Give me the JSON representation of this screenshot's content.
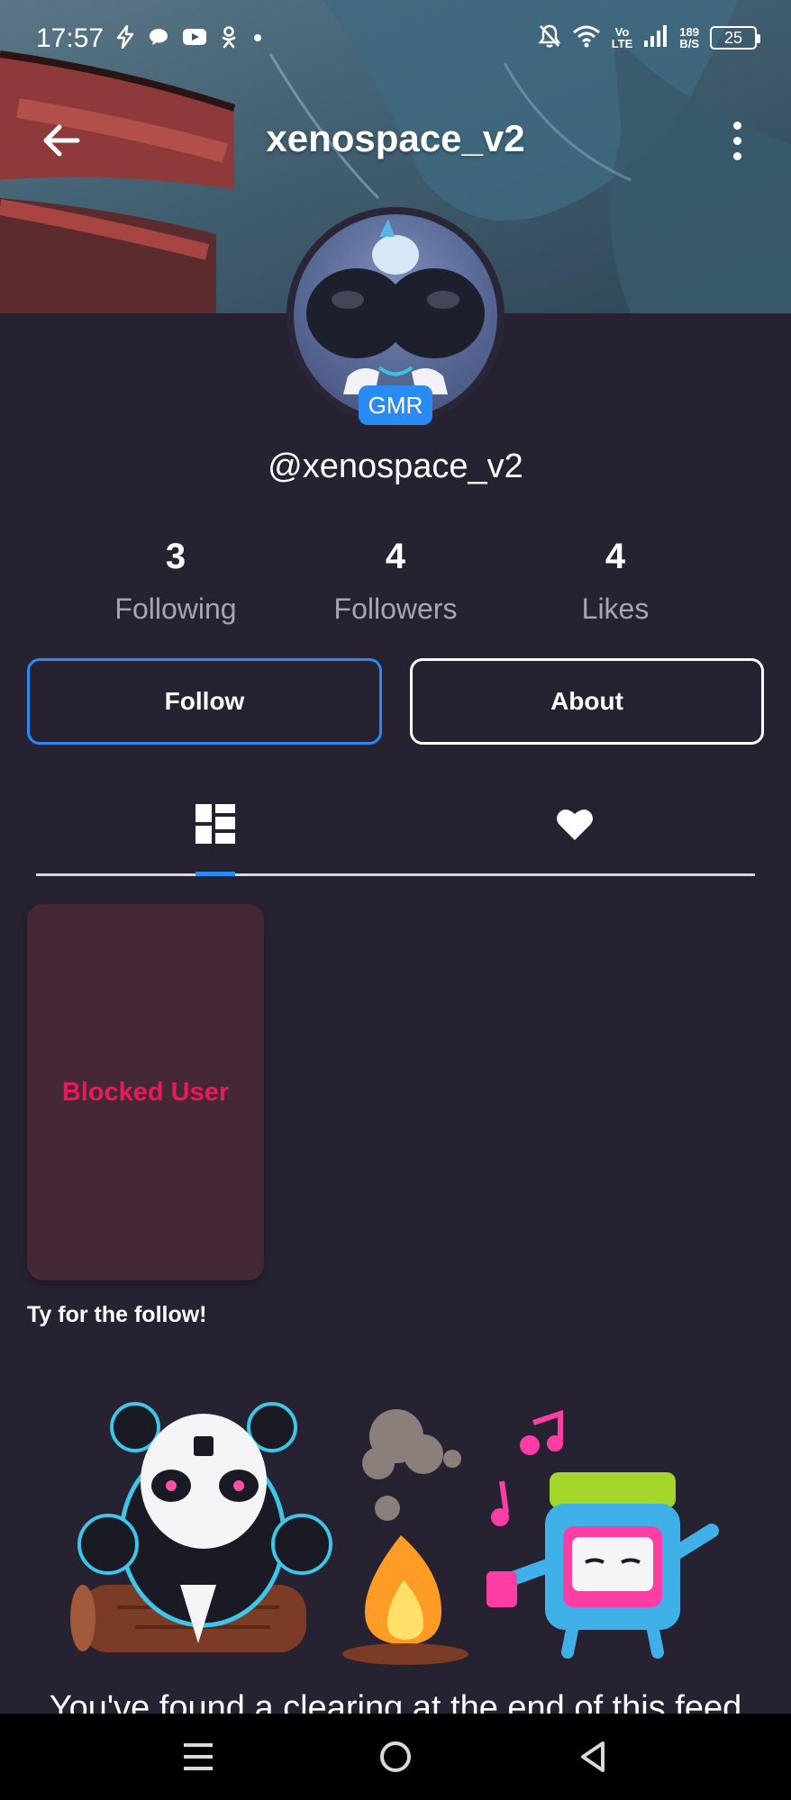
{
  "status_bar": {
    "time": "17:57",
    "network_top": "Vo",
    "network_bottom": "LTE",
    "speed_top": "189",
    "speed_bottom": "B/S",
    "battery": "25"
  },
  "header": {
    "title": "xenospace_v2",
    "back_icon": "arrow-left-icon",
    "more_icon": "more-vertical-icon"
  },
  "profile": {
    "badge": "GMR",
    "handle": "@xenospace_v2"
  },
  "stats": [
    {
      "value": "3",
      "label": "Following"
    },
    {
      "value": "4",
      "label": "Followers"
    },
    {
      "value": "4",
      "label": "Likes"
    }
  ],
  "actions": {
    "follow_label": "Follow",
    "about_label": "About"
  },
  "tabs": [
    {
      "icon": "grid-icon",
      "active": true
    },
    {
      "icon": "heart-icon",
      "active": false
    }
  ],
  "posts": [
    {
      "status_label": "Blocked User",
      "caption": "Ty for the follow!"
    }
  ],
  "feed_end": {
    "text": "You've found a clearing at the end of this feed"
  },
  "colors": {
    "accent": "#2a8bf2",
    "background": "#262232",
    "blocked_text": "#e8195c",
    "blocked_card": "#452835"
  }
}
